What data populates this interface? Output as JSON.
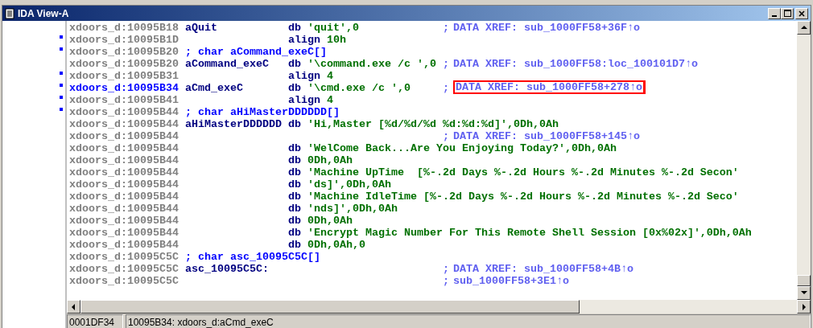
{
  "window": {
    "title": "IDA View-A"
  },
  "rows": [
    {
      "kind": "line",
      "address": "xdoors_d:10095B18",
      "selected": false,
      "marked": false,
      "label": "aQuit",
      "mnemonic": "db",
      "operand": "'quit',0",
      "comment_marker": ";",
      "comment": "DATA XREF: sub_1000FF58+36F↑o",
      "boxed": false
    },
    {
      "kind": "line",
      "address": "xdoors_d:10095B1D",
      "selected": false,
      "marked": true,
      "mnemonic": "align",
      "operand": "10h"
    },
    {
      "kind": "declaration",
      "address": "xdoors_d:10095B20",
      "selected": false,
      "marked": true,
      "text": "; char aCommand_exeC[]"
    },
    {
      "kind": "line",
      "address": "xdoors_d:10095B20",
      "selected": false,
      "marked": false,
      "label": "aCommand_exeC",
      "mnemonic": "db",
      "operand": "'\\command.exe /c ',0",
      "comment_marker": ";",
      "comment": "DATA XREF: sub_1000FF58:loc_100101D7↑o",
      "boxed": false
    },
    {
      "kind": "line",
      "address": "xdoors_d:10095B31",
      "selected": false,
      "marked": true,
      "mnemonic": "align",
      "operand": "4"
    },
    {
      "kind": "line",
      "address": "xdoors_d:10095B34",
      "selected": true,
      "marked": true,
      "label": "aCmd_exeC",
      "mnemonic": "db",
      "operand": "'\\cmd.exe /c ',0",
      "comment_marker": ";",
      "comment": "DATA XREF: sub_1000FF58+278↑o",
      "boxed": true
    },
    {
      "kind": "line",
      "address": "xdoors_d:10095B41",
      "selected": false,
      "marked": true,
      "mnemonic": "align",
      "operand": "4"
    },
    {
      "kind": "declaration",
      "address": "xdoors_d:10095B44",
      "selected": false,
      "marked": true,
      "text": "; char aHiMasterDDDDDD[]"
    },
    {
      "kind": "line",
      "address": "xdoors_d:10095B44",
      "selected": false,
      "marked": false,
      "label": "aHiMasterDDDDDD",
      "mnemonic": "db",
      "operand": "'Hi,Master [%d/%d/%d %d:%d:%d]',0Dh,0Ah"
    },
    {
      "kind": "line",
      "address": "xdoors_d:10095B44",
      "selected": false,
      "marked": false,
      "comment_marker": ";",
      "comment": "DATA XREF: sub_1000FF58+145↑o",
      "boxed": false
    },
    {
      "kind": "line",
      "address": "xdoors_d:10095B44",
      "selected": false,
      "marked": false,
      "mnemonic": "db",
      "operand": "'WelCome Back...Are You Enjoying Today?',0Dh,0Ah"
    },
    {
      "kind": "line",
      "address": "xdoors_d:10095B44",
      "selected": false,
      "marked": false,
      "mnemonic": "db",
      "operand": "0Dh,0Ah"
    },
    {
      "kind": "line",
      "address": "xdoors_d:10095B44",
      "selected": false,
      "marked": false,
      "mnemonic": "db",
      "operand": "'Machine UpTime  [%-.2d Days %-.2d Hours %-.2d Minutes %-.2d Secon'"
    },
    {
      "kind": "line",
      "address": "xdoors_d:10095B44",
      "selected": false,
      "marked": false,
      "mnemonic": "db",
      "operand": "'ds]',0Dh,0Ah"
    },
    {
      "kind": "line",
      "address": "xdoors_d:10095B44",
      "selected": false,
      "marked": false,
      "mnemonic": "db",
      "operand": "'Machine IdleTime [%-.2d Days %-.2d Hours %-.2d Minutes %-.2d Seco'"
    },
    {
      "kind": "line",
      "address": "xdoors_d:10095B44",
      "selected": false,
      "marked": false,
      "mnemonic": "db",
      "operand": "'nds]',0Dh,0Ah"
    },
    {
      "kind": "line",
      "address": "xdoors_d:10095B44",
      "selected": false,
      "marked": false,
      "mnemonic": "db",
      "operand": "0Dh,0Ah"
    },
    {
      "kind": "line",
      "address": "xdoors_d:10095B44",
      "selected": false,
      "marked": false,
      "mnemonic": "db",
      "operand": "'Encrypt Magic Number For This Remote Shell Session [0x%02x]',0Dh,0Ah"
    },
    {
      "kind": "line",
      "address": "xdoors_d:10095B44",
      "selected": false,
      "marked": false,
      "mnemonic": "db",
      "operand": "0Dh,0Ah,0"
    },
    {
      "kind": "declaration",
      "address": "xdoors_d:10095C5C",
      "selected": false,
      "marked": false,
      "text": "; char asc_10095C5C[]"
    },
    {
      "kind": "line",
      "address": "xdoors_d:10095C5C",
      "selected": false,
      "marked": false,
      "label": "asc_10095C5C:",
      "comment_marker": ";",
      "comment": "DATA XREF: sub_1000FF58+4B↑o",
      "boxed": false
    },
    {
      "kind": "line",
      "address": "xdoors_d:10095C5C",
      "selected": false,
      "marked": false,
      "comment_marker": ";",
      "comment": "sub_1000FF58+3E1↑o",
      "boxed": false
    }
  ],
  "status_bar": {
    "offset": "0001DF34",
    "location": "10095B34: xdoors_d:aCmd_exeC"
  }
}
